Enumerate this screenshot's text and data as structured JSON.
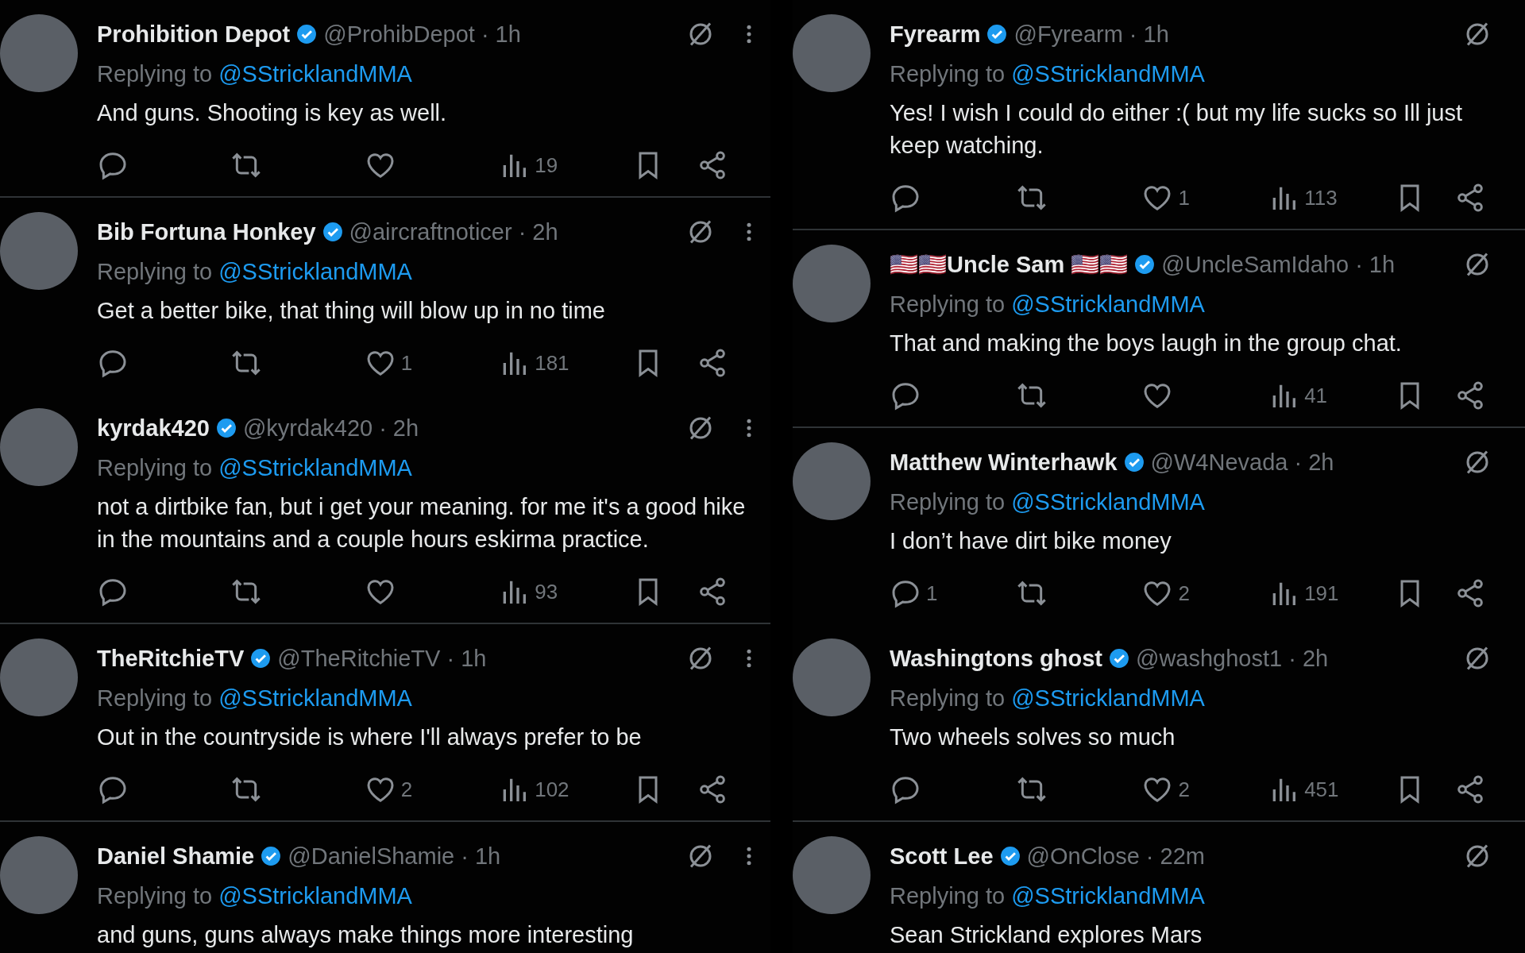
{
  "columns": [
    {
      "tweets": [
        {
          "name": "Prohibition Depot",
          "handle": "@ProhibDepot",
          "time": "· 1h",
          "more": true,
          "replying": "Replying to",
          "reply_to": "@SStricklandMMA",
          "text": "And guns. Shooting is key as well.",
          "views": "19",
          "divider": true
        },
        {
          "name": "Bib Fortuna Honkey",
          "handle": "@aircraftnoticer",
          "time": "· 2h",
          "more": true,
          "replying": "Replying to",
          "reply_to": "@SStricklandMMA",
          "text": "Get a better bike, that thing will blow up in no time",
          "likes": "1",
          "views": "181",
          "divider": false
        },
        {
          "name": "kyrdak420",
          "handle": "@kyrdak420",
          "time": "· 2h",
          "more": true,
          "replying": "Replying to",
          "reply_to": "@SStricklandMMA",
          "text": "not a dirtbike fan, but i get your meaning. for me it's a good hike in the mountains and a couple hours eskirma practice.",
          "views": "93",
          "divider": true
        },
        {
          "name": "TheRitchieTV",
          "handle": "@TheRitchieTV",
          "time": "· 1h",
          "more": true,
          "replying": "Replying to",
          "reply_to": "@SStricklandMMA",
          "text": "Out in the countryside is where I'll always prefer to be",
          "likes": "2",
          "views": "102",
          "divider": true
        },
        {
          "name": "Daniel Shamie",
          "handle": "@DanielShamie",
          "time": "· 1h",
          "more": true,
          "replying": "Replying to",
          "reply_to": "@SStricklandMMA",
          "text": "and guns, guns always make things more interesting",
          "divider": false
        }
      ]
    },
    {
      "tweets": [
        {
          "name": "Fyrearm",
          "handle": "@Fyrearm",
          "time": "· 1h",
          "more": false,
          "replying": "Replying to",
          "reply_to": "@SStricklandMMA",
          "text": "Yes!  I wish I could do either :( but my life sucks so Ill just keep watching.",
          "likes": "1",
          "views": "113",
          "divider": true
        },
        {
          "name": "🇺🇸🇺🇸Uncle Sam 🇺🇸🇺🇸",
          "handle": "@UncleSamIdaho",
          "time": "· 1h",
          "more": false,
          "replying": "Replying to",
          "reply_to": "@SStricklandMMA",
          "text": "That and making the boys laugh in the group chat.",
          "views": "41",
          "divider": true
        },
        {
          "name": "Matthew Winterhawk",
          "handle": "@W4Nevada",
          "time": "· 2h",
          "more": false,
          "replying": "Replying to",
          "reply_to": "@SStricklandMMA",
          "text": "I don’t have dirt bike money",
          "replies": "1",
          "likes": "2",
          "views": "191",
          "divider": false
        },
        {
          "name": "Washingtons ghost",
          "handle": "@washghost1",
          "time": "· 2h",
          "more": false,
          "replying": "Replying to",
          "reply_to": "@SStricklandMMA",
          "text": "Two wheels solves so much",
          "likes": "2",
          "views": "451",
          "divider": true
        },
        {
          "name": "Scott Lee",
          "handle": "@OnClose",
          "time": "· 22m",
          "more": false,
          "replying": "Replying to",
          "reply_to": "@SStricklandMMA",
          "text": "Sean Strickland explores Mars",
          "divider": false
        }
      ]
    }
  ]
}
